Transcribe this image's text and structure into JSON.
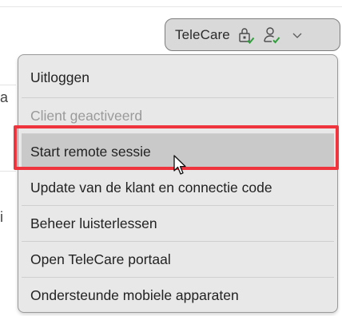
{
  "header": {
    "account_button": {
      "label": "TeleCare",
      "icons": [
        "lock-check-icon",
        "user-check-icon",
        "chevron-down-icon"
      ]
    }
  },
  "background": {
    "fragments": [
      "a",
      "i"
    ]
  },
  "menu": {
    "items": [
      {
        "label": "Uitloggen",
        "state": "normal"
      },
      {
        "label": "Client geactiveerd",
        "state": "disabled"
      },
      {
        "label": "Start remote sessie",
        "state": "hover"
      },
      {
        "label": "Update van de klant en connectie code",
        "state": "normal"
      },
      {
        "label": "Beheer luisterlessen",
        "state": "normal"
      },
      {
        "label": "Open TeleCare portaal",
        "state": "normal"
      },
      {
        "label": "Ondersteunde mobiele apparaten",
        "state": "normal"
      }
    ]
  },
  "colors": {
    "check_green": "#2e9e3a",
    "highlight_red": "#f0343e",
    "menu_bg": "#e8e8e8",
    "hover_bg": "#c9c9c9"
  }
}
